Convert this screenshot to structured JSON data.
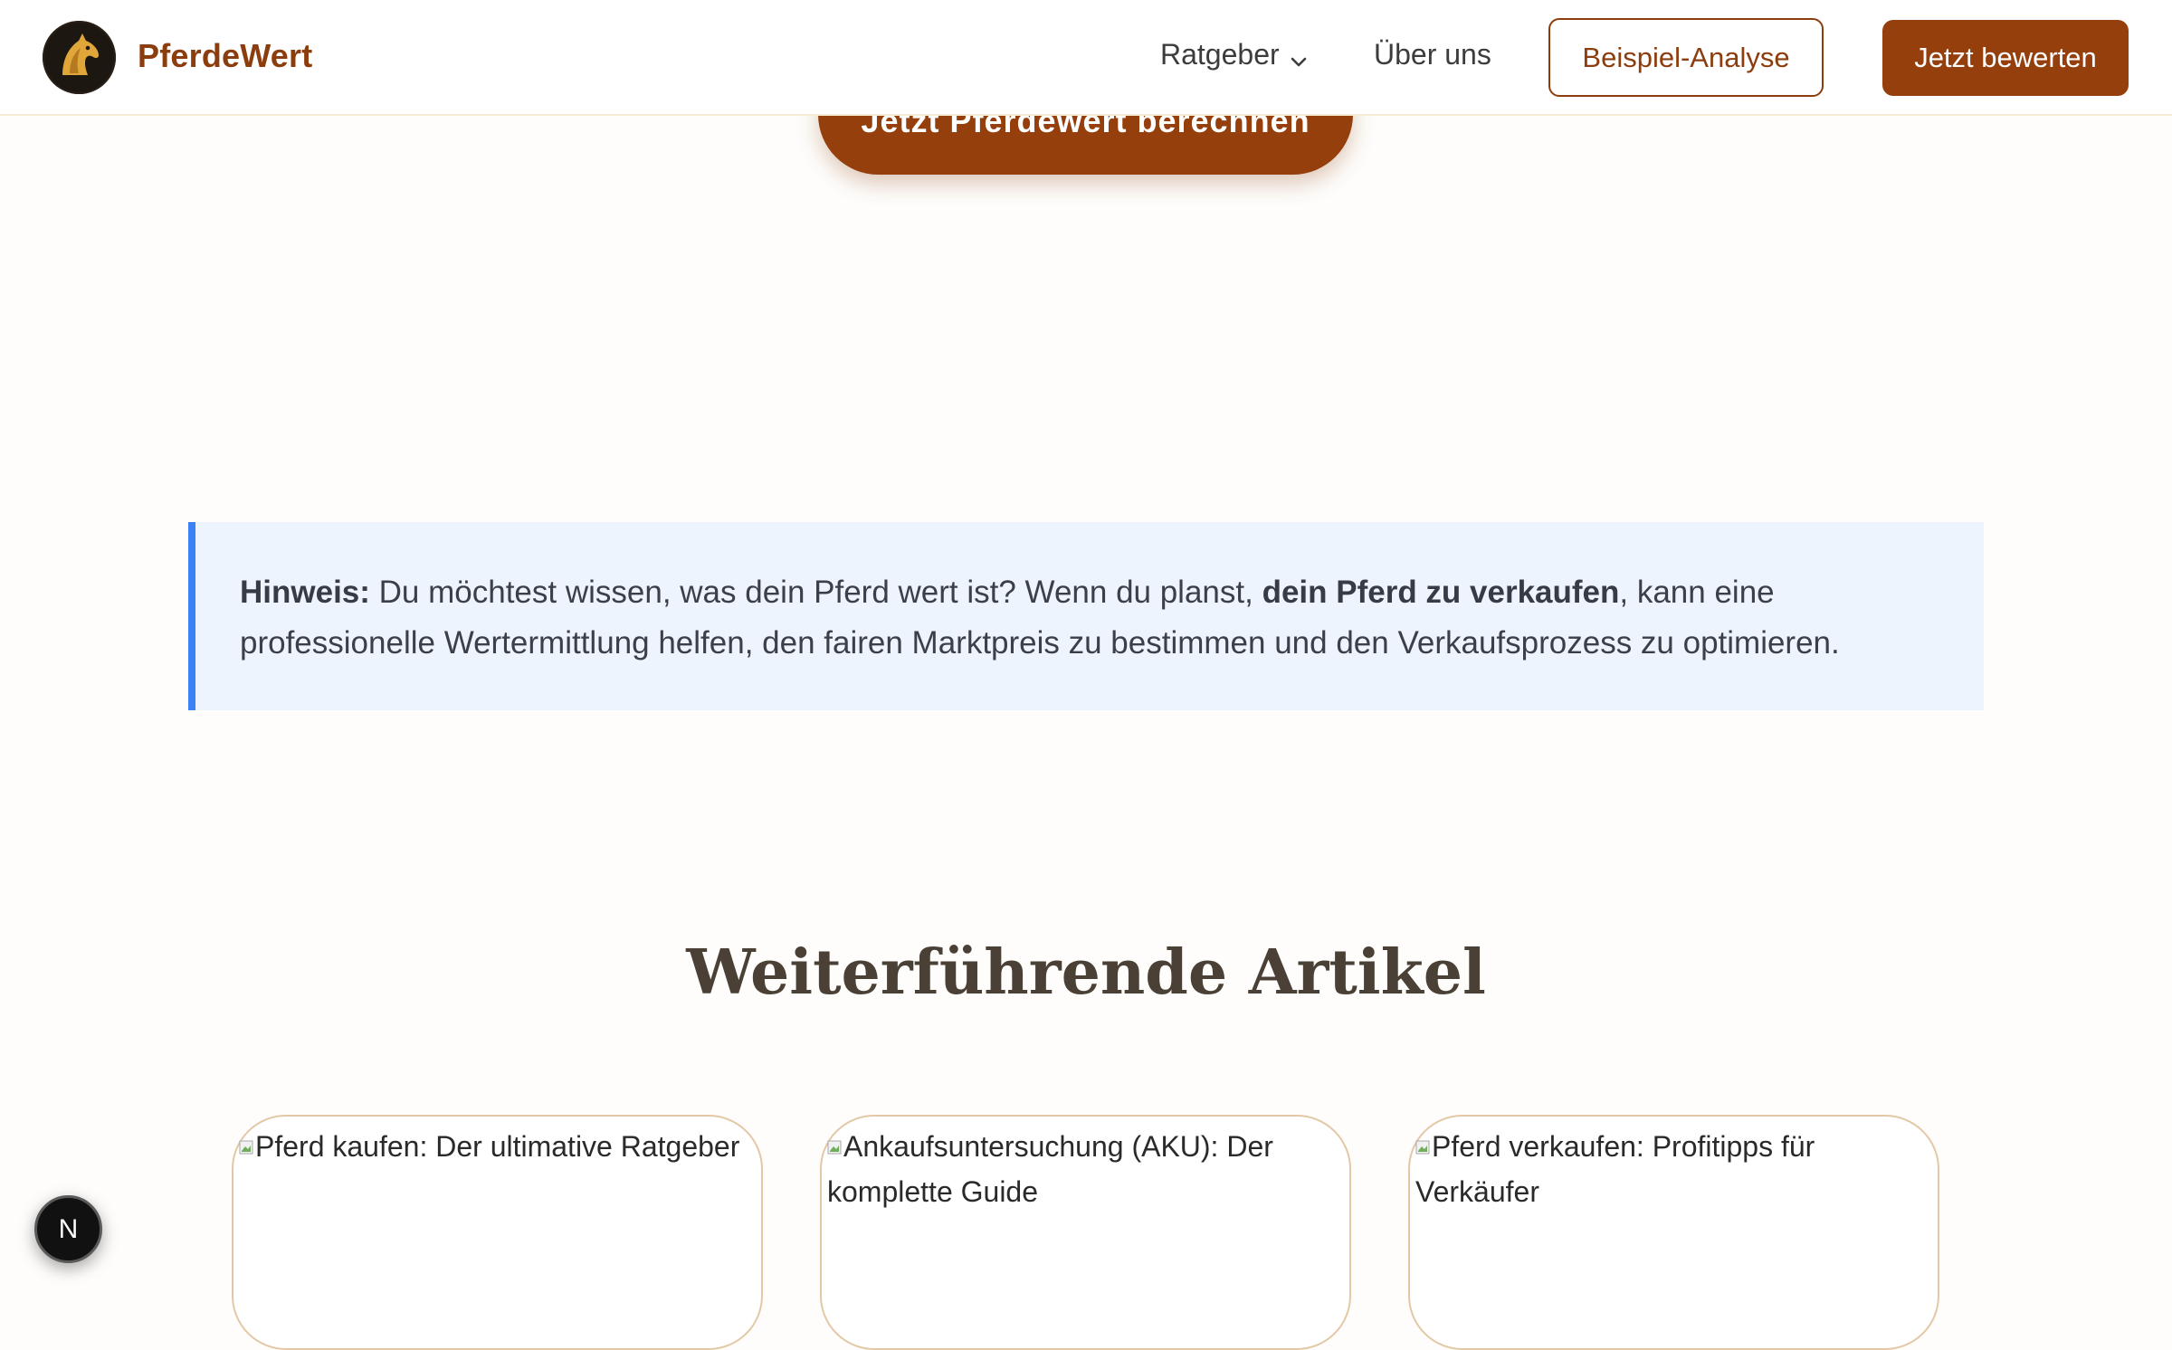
{
  "header": {
    "brand": "PferdeWert",
    "nav": {
      "ratgeber": "Ratgeber",
      "about": "Über uns"
    },
    "buttons": {
      "example": "Beispiel-Analyse",
      "evaluate": "Jetzt bewerten"
    }
  },
  "cta": {
    "label": "Jetzt Pferdewert berechnen"
  },
  "note": {
    "label": "Hinweis:",
    "text_before": " Du möchtest wissen, was dein Pferd wert ist? Wenn du planst, ",
    "link_text": "dein Pferd zu verkaufen",
    "text_after": ", kann eine professionelle Wertermittlung helfen, den fairen Marktpreis zu bestimmen und den Verkaufsprozess zu optimieren."
  },
  "related": {
    "title": "Weiterführende Artikel",
    "cards": [
      {
        "alt": "Pferd kaufen: Der ultimative Ratgeber"
      },
      {
        "alt": "Ankaufsuntersuchung (AKU): Der komplette Guide"
      },
      {
        "alt": "Pferd verkaufen: Profitipps für Verkäufer"
      }
    ]
  },
  "badge": {
    "letter": "N"
  },
  "colors": {
    "brand": "#8c3d0e",
    "primary_button": "#953f0c",
    "note_background": "#eef4fe",
    "note_accent": "#3b82f6",
    "card_border": "#e3c8a6",
    "heading": "#4a4036"
  },
  "icons": {
    "logo": "horse-head-icon",
    "dropdown": "chevron-down-icon",
    "broken_image": "broken-image-icon"
  }
}
